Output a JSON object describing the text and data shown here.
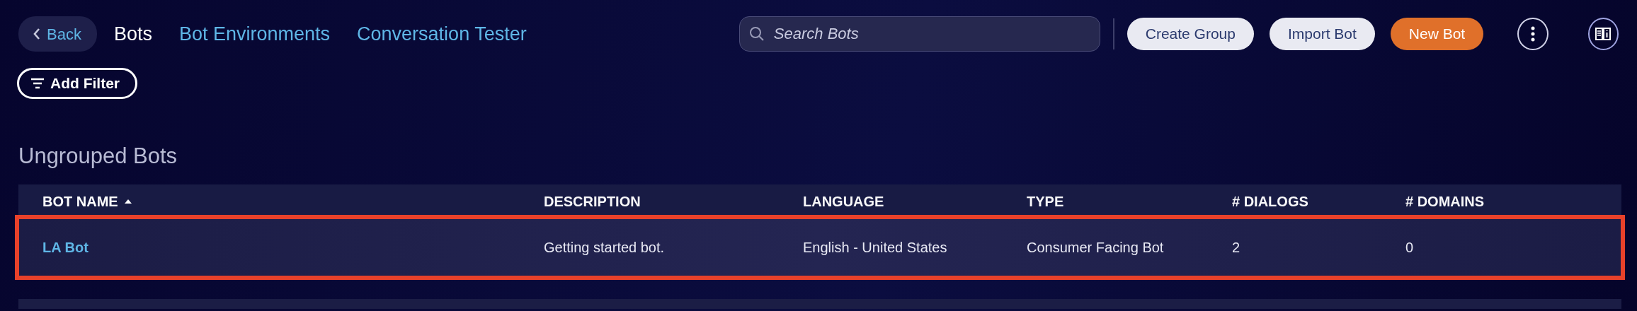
{
  "nav": {
    "back": "Back",
    "tabs": [
      {
        "label": "Bots",
        "selected": true
      },
      {
        "label": "Bot Environments",
        "selected": false
      },
      {
        "label": "Conversation Tester",
        "selected": false
      }
    ]
  },
  "search": {
    "placeholder": "Search Bots"
  },
  "buttons": [
    {
      "label": "Create Group",
      "kind": "secondary"
    },
    {
      "label": "Import Bot",
      "kind": "secondary"
    },
    {
      "label": "New Bot",
      "kind": "primary"
    }
  ],
  "filter_button": "Add Filter",
  "section_title": "Ungrouped Bots",
  "table": {
    "columns": [
      {
        "label": "BOT NAME",
        "sorted": true
      },
      {
        "label": "DESCRIPTION",
        "sorted": false
      },
      {
        "label": "LANGUAGE",
        "sorted": false
      },
      {
        "label": "TYPE",
        "sorted": false
      },
      {
        "label": "# DIALOGS",
        "sorted": false
      },
      {
        "label": "# DOMAINS",
        "sorted": false
      }
    ],
    "rows": [
      {
        "highlighted": true,
        "cells": [
          "LA Bot",
          "Getting started bot.",
          "English - United States",
          "Consumer Facing Bot",
          "2",
          "0"
        ]
      }
    ]
  }
}
